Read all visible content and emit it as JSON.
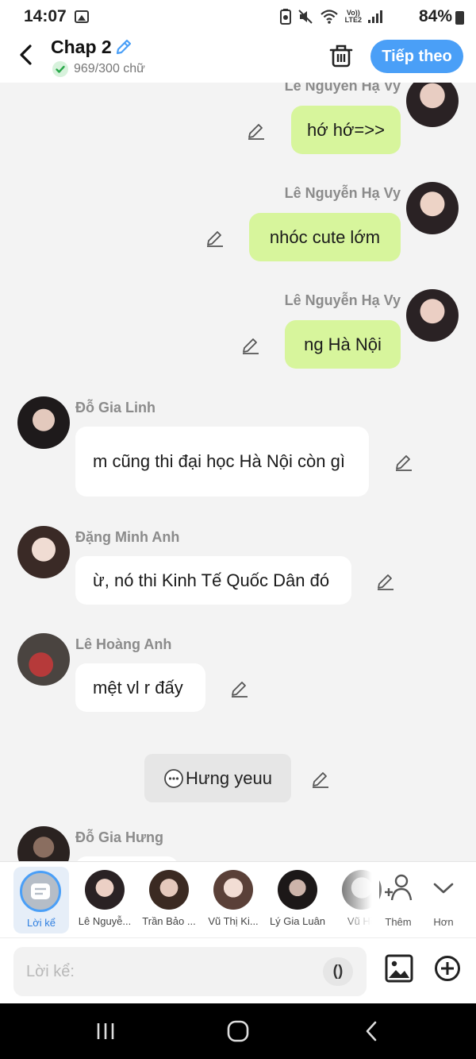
{
  "status_bar": {
    "time": "14:07",
    "battery": "84%",
    "network_top": "Vo))",
    "network_bottom": "LTE2"
  },
  "header": {
    "title": "Chap 2",
    "word_count": "969/300 chữ",
    "next_label": "Tiếp theo"
  },
  "messages": [
    {
      "sender": "Lê Nguyễn Hạ Vy",
      "text": "hớ hớ=>>"
    },
    {
      "sender": "Lê Nguyễn Hạ Vy",
      "text": "nhóc cute lớm"
    },
    {
      "sender": "Lê Nguyễn Hạ Vy",
      "text": "ng Hà Nội"
    },
    {
      "sender": "Đỗ Gia Linh",
      "text": "m cũng thi đại học Hà Nội còn gì"
    },
    {
      "sender": "Đặng Minh Anh",
      "text": "ừ, nó thi Kinh Tế Quốc Dân đó"
    },
    {
      "sender": "Lê Hoàng Anh",
      "text": "mệt vl r đấy"
    },
    {
      "sender": "",
      "text": "Hưng yeuu"
    },
    {
      "sender": "Đỗ Gia Hưng",
      "text": ""
    }
  ],
  "character_bar": {
    "narrator_label": "Lời kể",
    "characters": [
      "Lê Nguyễ...",
      "Trần Bảo ...",
      "Vũ Thị Ki...",
      "Lý Gia Luân",
      "Vũ Hồ"
    ],
    "add_label": "Thêm",
    "more_label": "Hơn"
  },
  "composer": {
    "placeholder": "Lời kể:",
    "paren_label": "()"
  },
  "colors": {
    "accent": "#4a9ff7",
    "right_bubble": "#d7f59c",
    "background": "#f3f3f3"
  }
}
